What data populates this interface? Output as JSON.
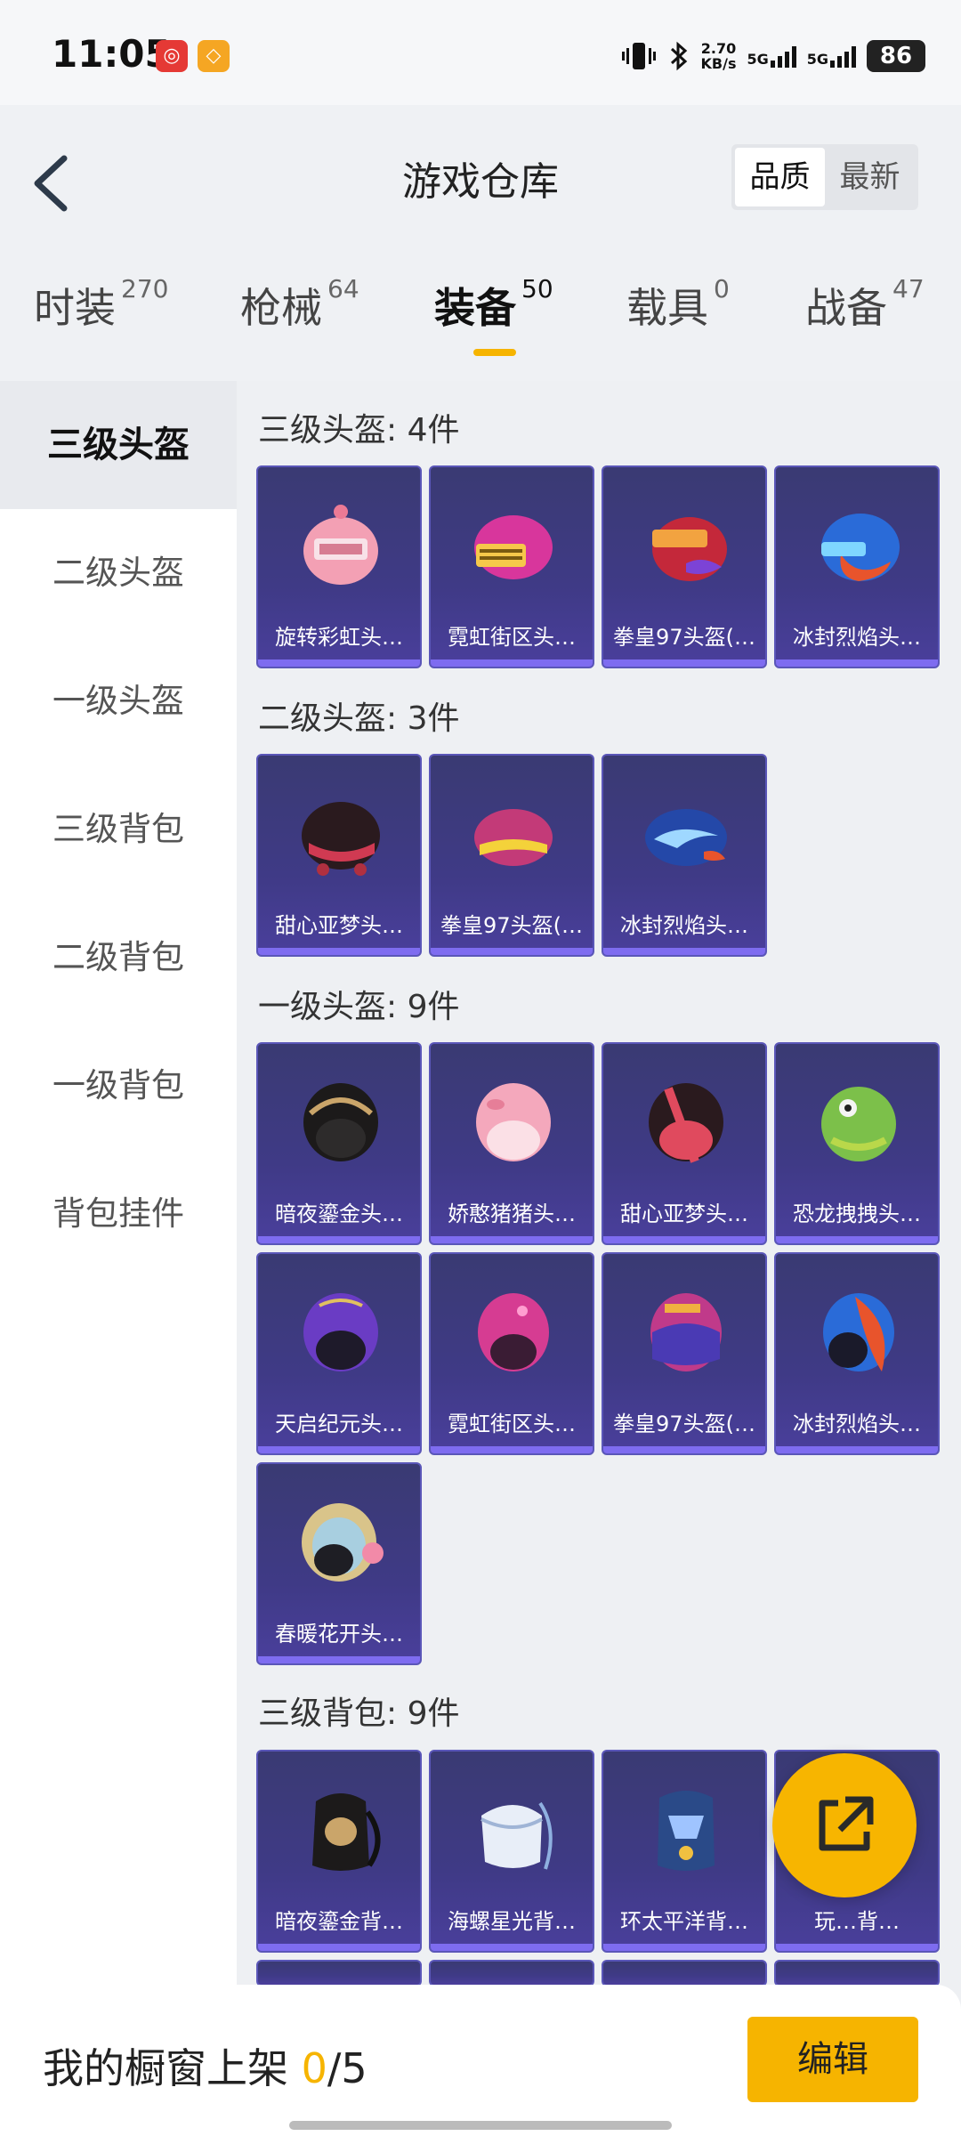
{
  "status_bar": {
    "time": "11:05",
    "speed_value": "2.70",
    "speed_unit": "KB/s",
    "net1": "5G",
    "net2": "5G",
    "battery": "86"
  },
  "header": {
    "title": "游戏仓库",
    "sort_options": [
      "品质",
      "最新"
    ],
    "sort_active": "品质"
  },
  "tabs": [
    {
      "label": "时装",
      "count": "270"
    },
    {
      "label": "枪械",
      "count": "64"
    },
    {
      "label": "装备",
      "count": "50"
    },
    {
      "label": "载具",
      "count": "0"
    },
    {
      "label": "战备",
      "count": "47"
    }
  ],
  "sidebar": {
    "items": [
      "三级头盔",
      "二级头盔",
      "一级头盔",
      "三级背包",
      "二级背包",
      "一级背包",
      "背包挂件"
    ]
  },
  "sections": [
    {
      "title": "三级头盔: 4件",
      "items": [
        "旋转彩虹头…",
        "霓虹街区头…",
        "拳皇97头盔(…",
        "冰封烈焰头…"
      ]
    },
    {
      "title": "二级头盔: 3件",
      "items": [
        "甜心亚梦头…",
        "拳皇97头盔(…",
        "冰封烈焰头…"
      ]
    },
    {
      "title": "一级头盔: 9件",
      "items": [
        "暗夜鎏金头…",
        "娇憨猪猪头…",
        "甜心亚梦头…",
        "恐龙拽拽头…",
        "天启纪元头…",
        "霓虹街区头…",
        "拳皇97头盔(…",
        "冰封烈焰头…",
        "春暖花开头…"
      ]
    },
    {
      "title": "三级背包: 9件",
      "items": [
        "暗夜鎏金背…",
        "海螺星光背…",
        "环太平洋背…",
        "玩…背…"
      ]
    }
  ],
  "bottom_bar": {
    "showcase_label": "我的橱窗上架",
    "showcase_count": "0",
    "showcase_total": "/5",
    "edit_label": "编辑"
  },
  "colors": {
    "accent": "#f6b400",
    "card_bg": "#3f3a86",
    "card_border": "#5a56b8"
  }
}
